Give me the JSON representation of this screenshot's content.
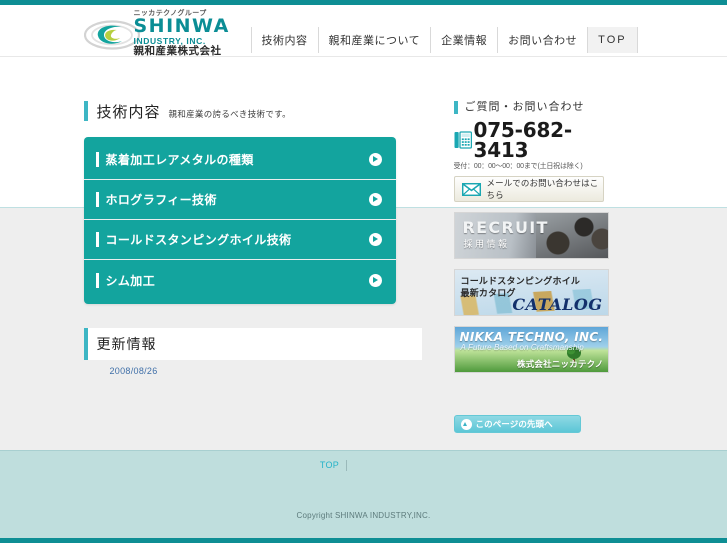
{
  "site": {
    "logo_kicker": "ニッカテクノグループ",
    "logo_main": "SHINWA",
    "logo_sub": "INDUSTRY, INC.",
    "logo_jp": "親和産業株式会社",
    "logo_icon": "swirl-logo-icon"
  },
  "nav": {
    "items": [
      {
        "label": "技術内容"
      },
      {
        "label": "親和産業について"
      },
      {
        "label": "企業情報"
      },
      {
        "label": "お問い合わせ"
      },
      {
        "label": "TOP"
      }
    ]
  },
  "page": {
    "title": "技術内容",
    "subtitle": "親和産業の誇るべき技術です。"
  },
  "tech_menu": {
    "items": [
      {
        "label": "蒸着加工レアメタルの種類"
      },
      {
        "label": "ホログラフィー技術"
      },
      {
        "label": "コールドスタンピングホイル技術"
      },
      {
        "label": "シム加工"
      }
    ]
  },
  "news": {
    "heading": "更新情報",
    "entries": [
      {
        "date": "2008/08/26"
      }
    ]
  },
  "sidebar": {
    "contact_title": "ご質問・お問い合わせ",
    "tel": "075-682-3413",
    "tel_note": "受付：00：00〜00：00まで(土日祝は除く)",
    "mail_label": "メールでのお問い合わせはこちら",
    "tel_icon": "telephone-icon",
    "mail_icon": "envelope-icon",
    "banners": [
      {
        "id": "recruit",
        "en": "RECRUIT",
        "jp": "採用情報"
      },
      {
        "id": "catalog",
        "jp_line1": "コールドスタンピングホイル",
        "jp_line2": "最新カタログ",
        "en": "CATALOG"
      },
      {
        "id": "nikka",
        "en": "NIKKA TECHNO, INC.",
        "tagline": "A Future Based on Craftsmanship",
        "jp": "株式会社ニッカテクノ"
      }
    ]
  },
  "pagetop": {
    "label": "このページの先頭へ",
    "icon": "arrow-up-circle-icon"
  },
  "footer": {
    "links": [
      {
        "label": "TOP"
      },
      {
        "label": ""
      },
      {
        "label": ""
      },
      {
        "label": ""
      },
      {
        "label": ""
      }
    ],
    "copyright": "Copyright SHINWA INDUSTRY,INC."
  },
  "colors": {
    "teal_rule": "#0e8e94",
    "accent": "#3db6c4",
    "panel": "#13a49e",
    "footer_band": "#bfdedd",
    "gray_band": "#eeeeee"
  }
}
